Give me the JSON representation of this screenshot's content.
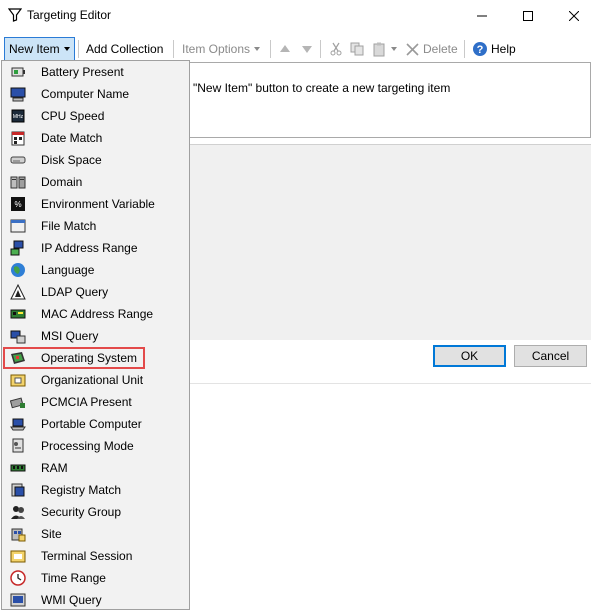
{
  "window": {
    "title": "Targeting Editor"
  },
  "toolbar": {
    "new_item": "New Item",
    "add_collection": "Add Collection",
    "item_options": "Item Options",
    "delete": "Delete",
    "help": "Help"
  },
  "main": {
    "hint": "\"New Item\" button to create a new targeting item"
  },
  "buttons": {
    "ok": "OK",
    "cancel": "Cancel"
  },
  "menu": {
    "highlighted": "Operating System",
    "items": [
      {
        "label": "Battery Present",
        "icon": "battery-icon"
      },
      {
        "label": "Computer Name",
        "icon": "computer-icon"
      },
      {
        "label": "CPU Speed",
        "icon": "cpu-icon"
      },
      {
        "label": "Date Match",
        "icon": "calendar-icon"
      },
      {
        "label": "Disk Space",
        "icon": "disk-icon"
      },
      {
        "label": "Domain",
        "icon": "domain-icon"
      },
      {
        "label": "Environment Variable",
        "icon": "environment-variable-icon"
      },
      {
        "label": "File Match",
        "icon": "file-icon"
      },
      {
        "label": "IP Address Range",
        "icon": "ip-address-icon"
      },
      {
        "label": "Language",
        "icon": "globe-icon"
      },
      {
        "label": "LDAP Query",
        "icon": "ldap-query-icon"
      },
      {
        "label": "MAC Address Range",
        "icon": "network-card-icon"
      },
      {
        "label": "MSI Query",
        "icon": "msi-query-icon"
      },
      {
        "label": "Operating System",
        "icon": "operating-system-icon"
      },
      {
        "label": "Organizational Unit",
        "icon": "organizational-unit-icon"
      },
      {
        "label": "PCMCIA Present",
        "icon": "pcmcia-icon"
      },
      {
        "label": "Portable Computer",
        "icon": "laptop-icon"
      },
      {
        "label": "Processing Mode",
        "icon": "processing-mode-icon"
      },
      {
        "label": "RAM",
        "icon": "ram-icon"
      },
      {
        "label": "Registry Match",
        "icon": "registry-icon"
      },
      {
        "label": "Security Group",
        "icon": "security-group-icon"
      },
      {
        "label": "Site",
        "icon": "site-icon"
      },
      {
        "label": "Terminal Session",
        "icon": "terminal-session-icon"
      },
      {
        "label": "Time Range",
        "icon": "clock-icon"
      },
      {
        "label": "WMI Query",
        "icon": "wmi-query-icon"
      }
    ]
  },
  "colors": {
    "highlight_border": "#e34a4a",
    "accent": "#0078d7",
    "menu_bg": "#f2f2f2"
  }
}
